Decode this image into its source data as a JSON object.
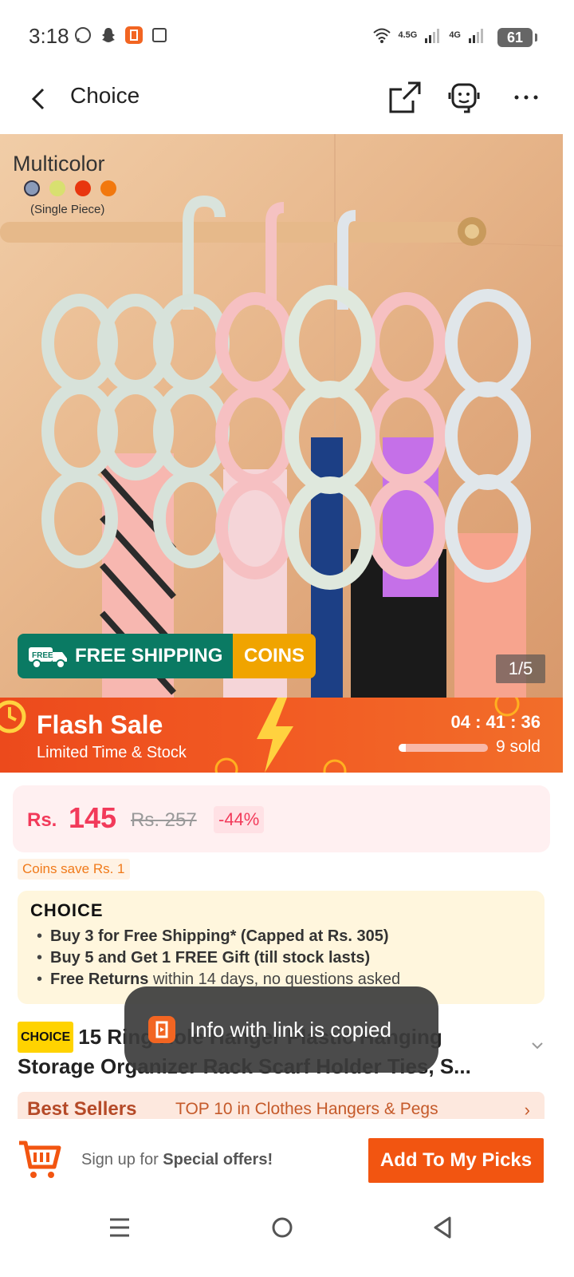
{
  "status_bar": {
    "time": "3:18",
    "network_1": "4.5G",
    "network_2": "4G",
    "battery": "61"
  },
  "header": {
    "title": "Choice"
  },
  "hero": {
    "variant_label": "Multicolor",
    "variant_note": "(Single Piece)",
    "variant_colors": [
      "#8a9ab8",
      "#d8e070",
      "#e8360e",
      "#f2780e"
    ],
    "free_shipping_label": "FREE SHIPPING",
    "free_badge": "FREE",
    "coins_label": "COINS",
    "page_counter": "1/5"
  },
  "flash_sale": {
    "title": "Flash Sale",
    "subtitle": "Limited Time & Stock",
    "timer": "04 : 41 : 36",
    "sold": "9 sold",
    "sold_fraction": 0.08
  },
  "price": {
    "currency": "Rs.",
    "current": "145",
    "original": "Rs. 257",
    "discount": "-44%",
    "coins_save": "Coins save Rs. 1"
  },
  "choice_box": {
    "logo": "CHOICE",
    "benefits": [
      {
        "bold": "Buy 3 for  Free Shipping* (Capped at Rs. 305)",
        "rest": ""
      },
      {
        "bold": "Buy 5 and Get 1 FREE Gift (till stock lasts)",
        "rest": ""
      },
      {
        "bold": "Free Returns",
        "rest": " within 14 days, no questions asked"
      }
    ]
  },
  "product": {
    "tag": "CHOICE",
    "title": "15 Ring Hole Hanger Plastic Hanging Storage Organizer Rack Scarf Holder Ties, S..."
  },
  "best_sellers": {
    "label": "Best Sellers",
    "text": "TOP 10 in Clothes Hangers & Pegs",
    "arrow": "›"
  },
  "toast": {
    "text": "Info with link is copied"
  },
  "bottom_bar": {
    "signup_prefix": "Sign up for ",
    "signup_bold": "Special offers!",
    "add_button": "Add To My Picks"
  },
  "colors": {
    "accent": "#f25511",
    "price": "#f23a5a",
    "free_shipping": "#0a7a63",
    "coins": "#f0a400"
  }
}
